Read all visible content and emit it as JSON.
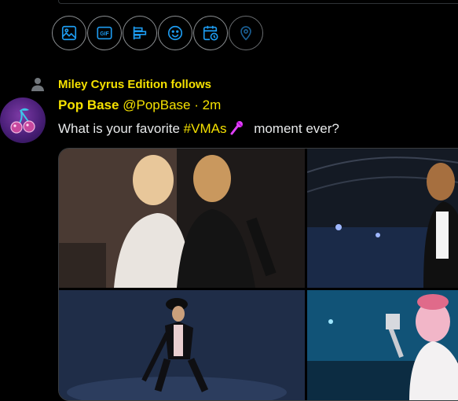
{
  "compose": {
    "tools": [
      {
        "name": "media-icon",
        "enabled": true
      },
      {
        "name": "gif-icon",
        "label": "GIF",
        "enabled": true
      },
      {
        "name": "poll-icon",
        "enabled": true
      },
      {
        "name": "emoji-icon",
        "enabled": true
      },
      {
        "name": "schedule-icon",
        "enabled": true
      },
      {
        "name": "location-icon",
        "enabled": false
      }
    ]
  },
  "tweet": {
    "social_context": "Miley Cyrus Edition follows",
    "author_name": "Pop Base",
    "handle": "@PopBase",
    "separator": "·",
    "time": "2m",
    "text_before": "What is your favorite ",
    "hashtag": "#VMAs",
    "text_after": " moment ever?",
    "media_count": 4
  },
  "colors": {
    "accent": "#f5e100",
    "icon": "#1d9bf0",
    "background": "#000000"
  }
}
